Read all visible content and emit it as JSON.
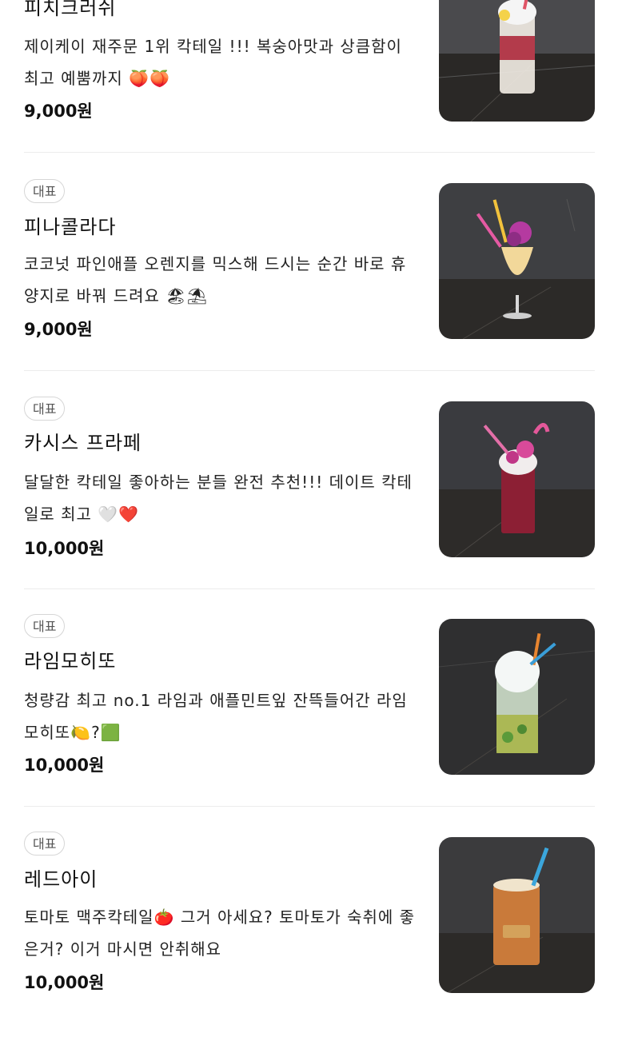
{
  "items": [
    {
      "badge": "",
      "name": "피치크러쉬",
      "desc": "제이케이 재주문 1위 칵테일 !!! 복숭아맛과 상큼함이 최고 예뿜까지 🍑🍑",
      "price": "9,000원"
    },
    {
      "badge": "대표",
      "name": "피나콜라다",
      "desc": "코코넛 파인애플 오렌지를 믹스해 드시는 순간 바로 휴양지로 바꿔 드려요 🏖⛱",
      "price": "9,000원"
    },
    {
      "badge": "대표",
      "name": "카시스 프라페",
      "desc": "달달한 칵테일 좋아하는 분들 완전 추천!!! 데이트 칵테일로 최고 🤍❤️",
      "price": "10,000원"
    },
    {
      "badge": "대표",
      "name": "라임모히또",
      "desc": "청량감 최고 no.1 라임과 애플민트잎 잔뜩들어간 라임모히또🍋?🟩",
      "price": "10,000원"
    },
    {
      "badge": "대표",
      "name": "레드아이",
      "desc": "토마토 맥주칵테일🍅 그거 아세요? 토마토가 숙취에 좋은거? 이거 마시면 안취해요",
      "price": "10,000원"
    }
  ],
  "icons": {
    "drink_photo": "cocktail-photo-icon"
  }
}
